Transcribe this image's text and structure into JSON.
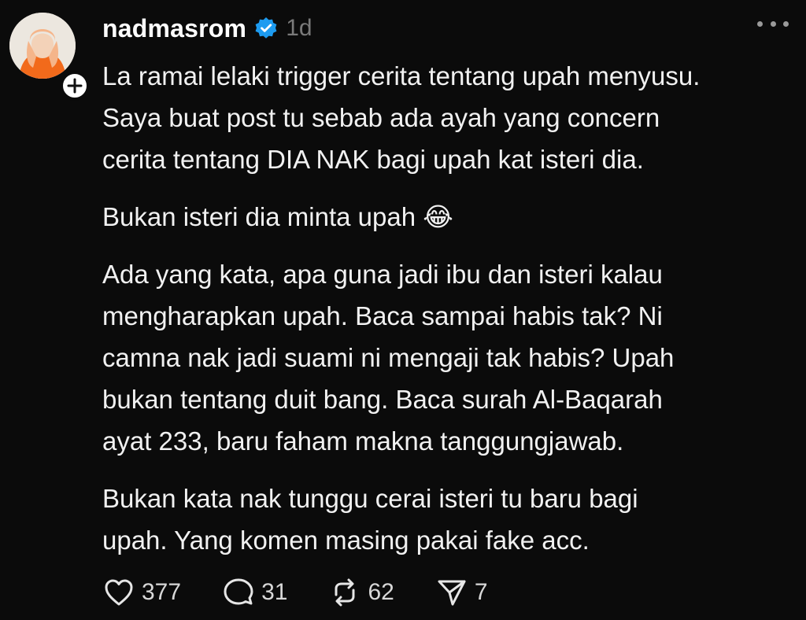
{
  "post": {
    "author": {
      "username": "nadmasrom",
      "verified": true,
      "time_ago": "1d"
    },
    "paragraphs": [
      "La ramai lelaki trigger cerita tentang upah menyusu.\nSaya buat post tu sebab ada ayah yang concern\ncerita tentang DIA NAK bagi upah kat isteri dia.",
      "Bukan isteri dia minta upah 😂",
      "Ada yang kata, apa guna jadi ibu dan isteri kalau\nmengharapkan upah. Baca sampai habis tak? Ni\ncamna nak jadi suami ni mengaji tak habis? Upah\nbukan tentang duit bang. Baca surah Al-Baqarah\nayat 233, baru faham makna tanggungjawab.",
      "Bukan kata nak tunggu cerai isteri tu baru bagi\nupah. Yang komen masing pakai fake acc."
    ],
    "actions": {
      "likes": "377",
      "comments": "31",
      "reposts": "62",
      "shares": "7"
    }
  },
  "icons": {
    "avatar": "profile-photo",
    "follow": "plus-icon",
    "verified": "verified-badge-icon",
    "more": "more-options-icon",
    "like": "heart-icon",
    "comment": "comment-bubble-icon",
    "repost": "repost-icon",
    "share": "send-icon"
  },
  "colors": {
    "background": "#0b0b0b",
    "text": "#f1f1f1",
    "muted": "#7a7a7a",
    "verified": "#1d9bf0",
    "avatar_outfit": "#f26a1b"
  }
}
